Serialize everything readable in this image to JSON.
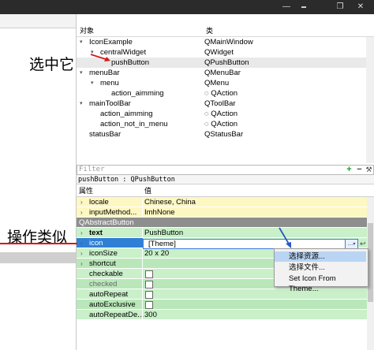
{
  "window": {
    "minimize_icon": "minimize-icon",
    "maximize_icon": "maximize-icon",
    "restore_icon": "restore-icon",
    "close_icon": "close-icon"
  },
  "object_inspector": {
    "header": {
      "col_object": "对象",
      "col_class": "类"
    },
    "tree": [
      {
        "name": "IconExample",
        "cls": "QMainWindow",
        "indent": 0,
        "expander": "▾"
      },
      {
        "name": "centralWidget",
        "cls": "QWidget",
        "indent": 1,
        "expander": "▾"
      },
      {
        "name": "pushButton",
        "cls": "QPushButton",
        "indent": 2,
        "expander": ""
      },
      {
        "name": "menuBar",
        "cls": "QMenuBar",
        "indent": 0,
        "expander": "▾"
      },
      {
        "name": "menu",
        "cls": "QMenu",
        "indent": 1,
        "expander": "▾"
      },
      {
        "name": "action_aimming",
        "cls": "QAction",
        "indent": 2,
        "expander": ""
      },
      {
        "name": "mainToolBar",
        "cls": "QToolBar",
        "indent": 0,
        "expander": "▾"
      },
      {
        "name": "action_aimming",
        "cls": "QAction",
        "indent": 1,
        "expander": ""
      },
      {
        "name": "action_not_in_menu",
        "cls": "QAction",
        "indent": 1,
        "expander": ""
      },
      {
        "name": "statusBar",
        "cls": "QStatusBar",
        "indent": 0,
        "expander": ""
      }
    ]
  },
  "filter": {
    "placeholder": "Filter",
    "add": "+",
    "remove": "−"
  },
  "property_editor": {
    "object_label": "pushButton : QPushButton",
    "header": {
      "col_property": "属性",
      "col_value": "值"
    },
    "rows": [
      {
        "key": "locale",
        "value": "Chinese, China",
        "style": "y",
        "expander": "›"
      },
      {
        "key": "inputMethod...",
        "value": "ImhNone",
        "style": "y",
        "expander": "›"
      },
      {
        "key": "QAbstractButton",
        "value": "",
        "style": "section",
        "expander": ""
      },
      {
        "key": "text",
        "value": "PushButton",
        "style": "g",
        "expander": "›"
      },
      {
        "key": "icon",
        "value": "[Theme]",
        "style": "sel",
        "expander": "›"
      },
      {
        "key": "iconSize",
        "value": "20 x 20",
        "style": "g",
        "expander": "›"
      },
      {
        "key": "shortcut",
        "value": "",
        "style": "g",
        "expander": "›"
      },
      {
        "key": "checkable",
        "value": "",
        "style": "g",
        "expander": ""
      },
      {
        "key": "checked",
        "value": "",
        "style": "g",
        "expander": ""
      },
      {
        "key": "autoRepeat",
        "value": "",
        "style": "g",
        "expander": ""
      },
      {
        "key": "autoExclusive",
        "value": "",
        "style": "g",
        "expander": ""
      },
      {
        "key": "autoRepeatDe...",
        "value": "300",
        "style": "g",
        "expander": ""
      }
    ],
    "icon_button_label": "...",
    "icon_reset": "↩"
  },
  "context_menu": {
    "items": [
      "选择资源...",
      "选择文件...",
      "Set Icon From Theme..."
    ]
  },
  "annotations": {
    "select_it": "选中它",
    "operation_similar": "操作类似"
  },
  "colors": {
    "annotation_arrow": "#d41919",
    "selection": "#2f7fd5"
  }
}
